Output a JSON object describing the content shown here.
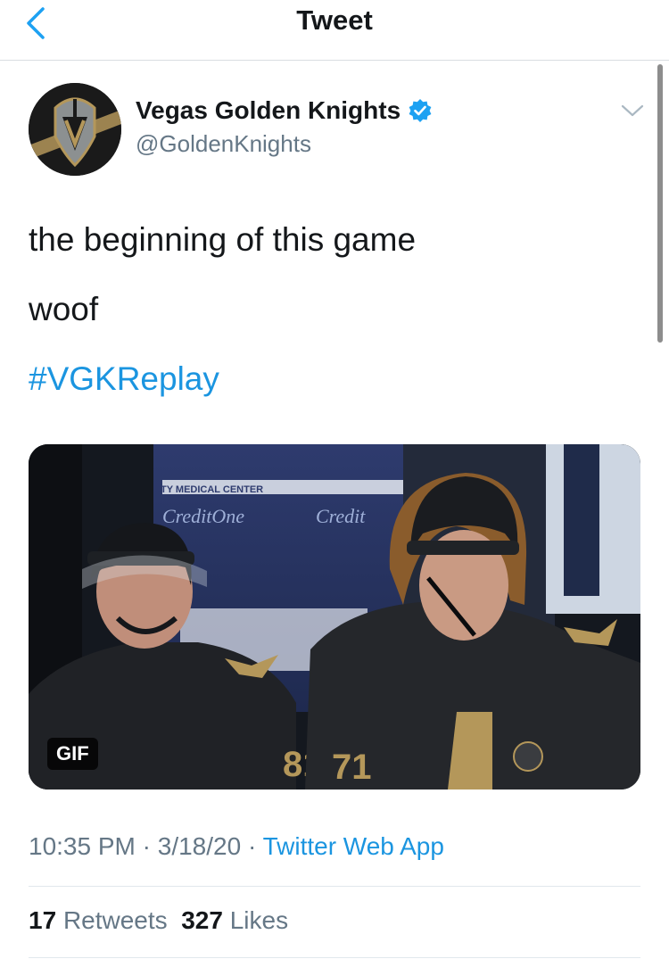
{
  "nav": {
    "title": "Tweet",
    "back_icon": "chevron-left-icon"
  },
  "author": {
    "display_name": "Vegas Golden Knights",
    "handle": "@GoldenKnights",
    "verified": true,
    "verified_icon": "verified-badge-icon"
  },
  "menu_icon": "chevron-down-icon",
  "tweet": {
    "line1": "the beginning of this game",
    "line2": "woof",
    "hashtag": "#VGKReplay"
  },
  "media": {
    "badge": "GIF",
    "board_text_1": "TY MEDICAL CENTER",
    "board_text_2": "CreditOne",
    "board_text_3": "Credit",
    "jersey_left": "81",
    "jersey_right": "71"
  },
  "meta": {
    "time": "10:35 PM",
    "separator1": " · ",
    "date": "3/18/20",
    "separator2": " · ",
    "source": "Twitter Web App"
  },
  "stats": {
    "retweets_count": "17",
    "retweets_label": "Retweets",
    "likes_count": "327",
    "likes_label": "Likes"
  },
  "colors": {
    "link": "#1b95e0",
    "secondary_text": "#657786",
    "primary_text": "#14171a",
    "team_gold": "#b4975a"
  }
}
